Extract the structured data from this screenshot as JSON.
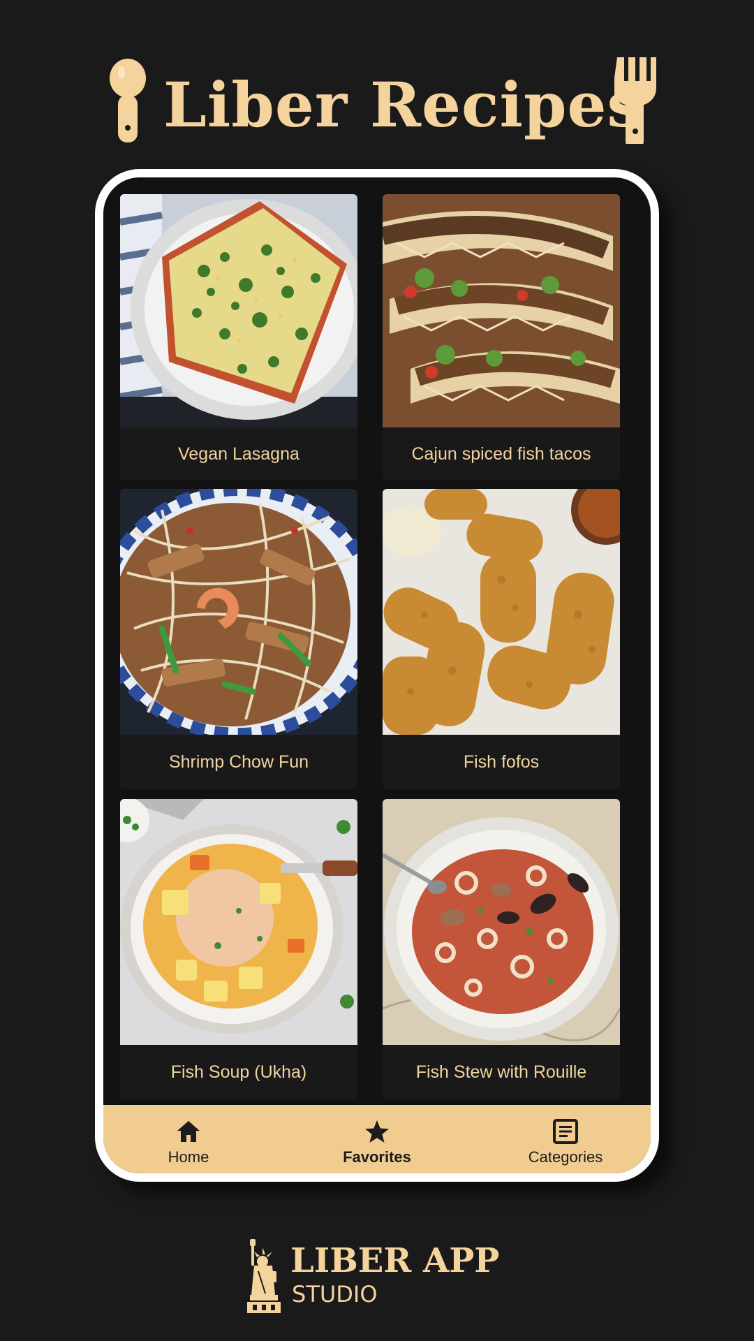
{
  "header": {
    "title": "Liber Recipes",
    "icons": [
      "spoon-icon",
      "fork-icon"
    ]
  },
  "recipes": [
    {
      "name": "Vegan Lasagna",
      "photo": "vegan-lasagna-photo"
    },
    {
      "name": "Cajun spiced fish tacos",
      "photo": "fish-tacos-photo"
    },
    {
      "name": "Shrimp Chow Fun",
      "photo": "shrimp-chow-fun-photo"
    },
    {
      "name": "Fish fofos",
      "photo": "fish-fofos-photo"
    },
    {
      "name": "Fish Soup (Ukha)",
      "photo": "fish-soup-photo"
    },
    {
      "name": "Fish Stew with Rouille",
      "photo": "fish-stew-photo"
    }
  ],
  "bottom_nav": {
    "items": [
      {
        "label": "Home",
        "icon": "home-icon",
        "active": false
      },
      {
        "label": "Favorites",
        "icon": "star-icon",
        "active": true
      },
      {
        "label": "Categories",
        "icon": "categories-icon",
        "active": false
      }
    ]
  },
  "footer": {
    "brand_line1": "LIBER APP",
    "brand_line2": "STUDIO",
    "icon": "statue-of-liberty-icon"
  },
  "colors": {
    "background": "#1b1a1a",
    "accent": "#f5d39c",
    "nav_background": "#f0cc90",
    "card_background": "#191919"
  }
}
